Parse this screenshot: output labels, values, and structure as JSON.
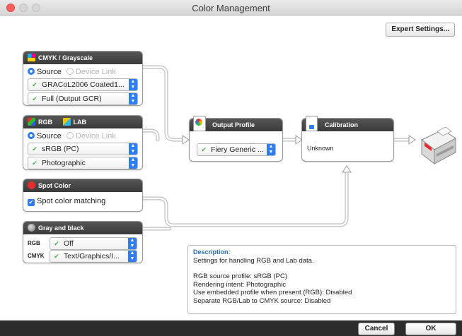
{
  "window": {
    "title": "Color Management"
  },
  "toolbar": {
    "expert_label": "Expert Settings..."
  },
  "cmyk_panel": {
    "title": "CMYK / Grayscale",
    "source_label": "Source",
    "device_link_label": "Device Link",
    "profile_value": "GRACoL2006 Coated1...",
    "intent_value": "Full (Output GCR)"
  },
  "rgb_panel": {
    "title_rgb": "RGB",
    "title_lab": "LAB",
    "source_label": "Source",
    "device_link_label": "Device Link",
    "profile_value": "sRGB (PC)",
    "intent_value": "Photographic"
  },
  "spot_panel": {
    "title": "Spot Color",
    "checkbox_label": "Spot color matching",
    "checked": true
  },
  "gray_panel": {
    "title": "Gray and black",
    "rgb_label": "RGB",
    "rgb_value": "Off",
    "cmyk_label": "CMYK",
    "cmyk_value": "Text/Graphics/I..."
  },
  "output_panel": {
    "title": "Output Profile",
    "profile_value": "Fiery Generic ..."
  },
  "calibration_panel": {
    "title": "Calibration",
    "status": "Unknown"
  },
  "description": {
    "title": "Description:",
    "summary": "Settings for handling RGB and Lab data.",
    "lines": [
      "RGB source profile: sRGB (PC)",
      "Rendering intent: Photographic",
      "Use embedded profile when present (RGB): Disabled",
      "Separate RGB/Lab to CMYK source: Disabled"
    ]
  },
  "footer": {
    "cancel_label": "Cancel",
    "ok_label": "OK"
  },
  "colors": {
    "accent": "#2e7df6",
    "header": "#3a3a3a",
    "check": "#48b148",
    "close": "#fc605c"
  }
}
